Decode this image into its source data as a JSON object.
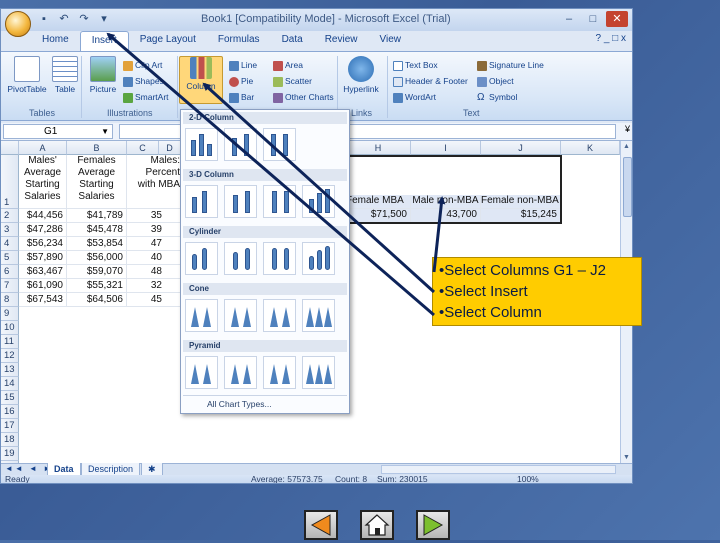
{
  "app": {
    "title": "Book1 [Compatibility Mode] - Microsoft Excel (Trial)",
    "tabs": [
      "Home",
      "Insert",
      "Page Layout",
      "Formulas",
      "Data",
      "Review",
      "View"
    ],
    "active_tab": "Insert"
  },
  "ribbon": {
    "pivottable": "PivotTable",
    "table": "Table",
    "picture": "Picture",
    "clipart": "Clip Art",
    "shapes": "Shapes",
    "smartart": "SmartArt",
    "column": "Column",
    "line": "Line",
    "pie": "Pie",
    "bar": "Bar",
    "area": "Area",
    "scatter": "Scatter",
    "other_charts": "Other Charts",
    "hyperlink": "Hyperlink",
    "textbox": "Text Box",
    "header_footer": "Header & Footer",
    "wordart": "WordArt",
    "signature_line": "Signature Line",
    "object": "Object",
    "symbol": "Symbol",
    "groups": {
      "tables": "Tables",
      "illustrations": "Illustrations",
      "links": "Links",
      "text": "Text"
    }
  },
  "formula_bar": {
    "name_box": "G1",
    "formula": ""
  },
  "columns": [
    "A",
    "B",
    "C",
    "D",
    "H",
    "I",
    "J",
    "K"
  ],
  "rows": [
    "1",
    "2",
    "3",
    "4",
    "5",
    "6",
    "7",
    "8",
    "9",
    "10",
    "11",
    "12",
    "13",
    "14",
    "15",
    "16",
    "17",
    "18",
    "19",
    "20",
    "21"
  ],
  "headers": {
    "b": "Males' Average Starting Salaries",
    "c": "Females Average Starting Salaries",
    "d": "Males: Percent with MBA",
    "h": "Female MBA",
    "i": "Male non-MBA",
    "j": "Female non-MBA"
  },
  "table": [
    [
      "$44,456",
      "$41,789",
      "35"
    ],
    [
      "$47,286",
      "$45,478",
      "39"
    ],
    [
      "$56,234",
      "$53,854",
      "47"
    ],
    [
      "$57,890",
      "$56,000",
      "40"
    ],
    [
      "$63,467",
      "$59,070",
      "48"
    ],
    [
      "$61,090",
      "$55,321",
      "32"
    ],
    [
      "$67,543",
      "$64,506",
      "45"
    ]
  ],
  "row2_right": {
    "h": "$71,500",
    "i": "43,700",
    "j": "$15,245"
  },
  "chart_menu": {
    "sections": [
      "2-D Column",
      "3-D Column",
      "Cylinder",
      "Cone",
      "Pyramid"
    ],
    "footer": "All Chart Types..."
  },
  "sheets": [
    "Data",
    "Description"
  ],
  "status": {
    "ready": "Ready",
    "average": "Average: 57573.75",
    "count": "Count: 8",
    "sum": "Sum: 230015",
    "zoom": "100%"
  },
  "callout": {
    "lines": [
      "•Select Columns G1 – J2",
      "•Select Insert",
      "•Select Column"
    ]
  }
}
